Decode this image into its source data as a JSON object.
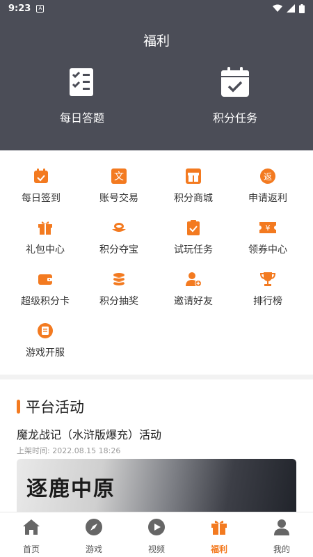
{
  "status": {
    "time": "9:23",
    "notif": "A"
  },
  "header": {
    "title": "福利"
  },
  "top_actions": [
    {
      "label": "每日答题",
      "icon": "quiz-clipboard-icon"
    },
    {
      "label": "积分任务",
      "icon": "calendar-check-icon"
    }
  ],
  "grid": [
    {
      "label": "每日签到",
      "icon": "signin-icon"
    },
    {
      "label": "账号交易",
      "icon": "trade-icon",
      "glyph": "文"
    },
    {
      "label": "积分商城",
      "icon": "mall-icon"
    },
    {
      "label": "申请返利",
      "icon": "rebate-icon",
      "glyph": "返"
    },
    {
      "label": "礼包中心",
      "icon": "gift-icon"
    },
    {
      "label": "积分夺宝",
      "icon": "treasure-icon"
    },
    {
      "label": "试玩任务",
      "icon": "trial-task-icon"
    },
    {
      "label": "领券中心",
      "icon": "coupon-icon",
      "glyph": "¥"
    },
    {
      "label": "超级积分卡",
      "icon": "wallet-card-icon"
    },
    {
      "label": "积分抽奖",
      "icon": "lottery-icon"
    },
    {
      "label": "邀请好友",
      "icon": "invite-icon"
    },
    {
      "label": "排行榜",
      "icon": "trophy-icon"
    },
    {
      "label": "游戏开服",
      "icon": "server-icon"
    }
  ],
  "activity": {
    "title": "平台活动",
    "name": "魔龙战记（水浒版爆充）活动",
    "time": "上架时间: 2022.08.15 18:26",
    "banner_text": "逐鹿中原"
  },
  "tabs": [
    {
      "label": "首页",
      "icon": "home-icon",
      "active": false
    },
    {
      "label": "游戏",
      "icon": "compass-icon",
      "active": false
    },
    {
      "label": "视频",
      "icon": "play-icon",
      "active": false
    },
    {
      "label": "福利",
      "icon": "gift-icon",
      "active": true
    },
    {
      "label": "我的",
      "icon": "user-icon",
      "active": false
    }
  ],
  "colors": {
    "accent": "#f37a20",
    "header": "#4b4d57"
  }
}
